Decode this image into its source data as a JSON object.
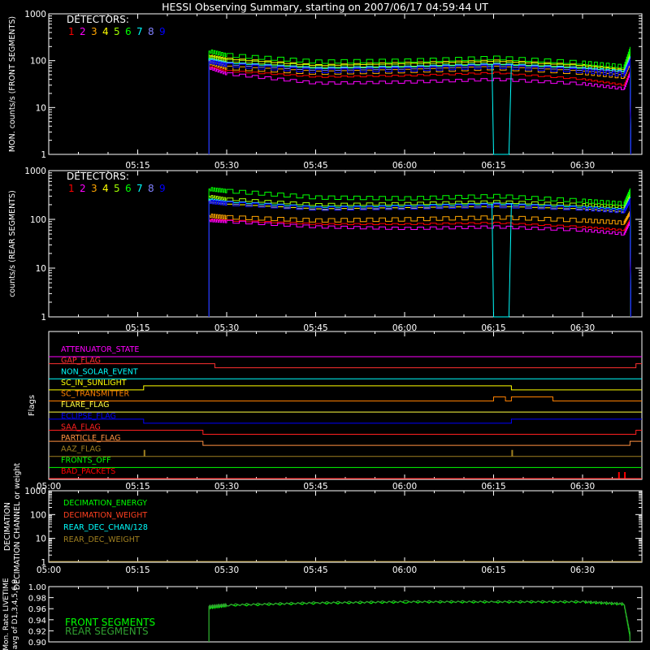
{
  "page_title": "HESSI Observing Summary, starting on 2007/06/17 04:59:44 UT",
  "time_axis": {
    "start": "05:00",
    "end": "06:40",
    "ticks": [
      "05:00",
      "05:15",
      "05:30",
      "05:45",
      "06:00",
      "06:15",
      "06:30"
    ],
    "panel_ticks": [
      "05:15",
      "05:30",
      "05:45",
      "06:00",
      "06:15",
      "06:30"
    ]
  },
  "detector_colors": [
    "#ff0000",
    "#ff00ff",
    "#ffa500",
    "#ffff00",
    "#a0ff00",
    "#00ff00",
    "#00ffff",
    "#8080ff",
    "#0000ff"
  ],
  "chart_data": [
    {
      "type": "line",
      "title": "HESSI Observing Summary, starting on 2007/06/17 04:59:44 UT",
      "ylabel": "MON. counts/s (FRONT SEGMENTS)",
      "yscale": "log",
      "ylim": [
        1,
        1000
      ],
      "ytick_labels": [
        "1",
        "10",
        "100",
        "1000"
      ],
      "legend_title": "DETECTORS:",
      "legend": [
        "1",
        "2",
        "3",
        "4",
        "5",
        "6",
        "7",
        "8",
        "9"
      ],
      "xticks": [
        "05:15",
        "05:30",
        "05:45",
        "06:00",
        "06:15",
        "06:30"
      ],
      "x": [
        "05:27",
        "05:30",
        "05:45",
        "06:00",
        "06:15",
        "06:30",
        "06:37",
        "06:38"
      ],
      "series": [
        {
          "name": "1",
          "color": "#ff0000",
          "values": [
            75,
            60,
            45,
            48,
            55,
            40,
            30,
            60
          ]
        },
        {
          "name": "2",
          "color": "#ff00ff",
          "values": [
            70,
            52,
            33,
            35,
            40,
            32,
            25,
            55
          ]
        },
        {
          "name": "3",
          "color": "#ffa500",
          "values": [
            90,
            70,
            55,
            60,
            70,
            55,
            45,
            90
          ]
        },
        {
          "name": "4",
          "color": "#ffff00",
          "values": [
            130,
            110,
            80,
            90,
            100,
            80,
            65,
            150
          ]
        },
        {
          "name": "5",
          "color": "#a0ff00",
          "values": [
            120,
            100,
            75,
            80,
            90,
            75,
            60,
            140
          ]
        },
        {
          "name": "6",
          "color": "#00ff00",
          "values": [
            160,
            130,
            95,
            100,
            115,
            90,
            75,
            180
          ]
        },
        {
          "name": "7",
          "color": "#00ffff",
          "values": [
            110,
            90,
            70,
            75,
            85,
            70,
            60,
            120
          ]
        },
        {
          "name": "8",
          "color": "#8080ff",
          "values": [
            100,
            85,
            65,
            70,
            80,
            65,
            55,
            110
          ]
        },
        {
          "name": "9",
          "color": "#0000ff",
          "values": [
            95,
            80,
            60,
            65,
            75,
            60,
            50,
            100
          ]
        }
      ]
    },
    {
      "type": "line",
      "ylabel": "counts/s (REAR SEGMENTS)",
      "yscale": "log",
      "ylim": [
        1,
        1000
      ],
      "ytick_labels": [
        "1",
        "10",
        "100",
        "1000"
      ],
      "legend_title": "DETECTORS:",
      "legend": [
        "1",
        "2",
        "3",
        "4",
        "5",
        "6",
        "7",
        "8",
        "9"
      ],
      "xticks": [
        "05:15",
        "05:30",
        "05:45",
        "06:00",
        "06:15",
        "06:30"
      ],
      "x": [
        "05:27",
        "05:30",
        "05:45",
        "06:00",
        "06:15",
        "06:30",
        "06:37",
        "06:38"
      ],
      "series": [
        {
          "name": "1",
          "color": "#ff0000",
          "values": [
            100,
            95,
            80,
            80,
            85,
            70,
            60,
            100
          ]
        },
        {
          "name": "2",
          "color": "#ff00ff",
          "values": [
            95,
            90,
            70,
            65,
            70,
            60,
            50,
            90
          ]
        },
        {
          "name": "3",
          "color": "#ffa500",
          "values": [
            120,
            110,
            95,
            100,
            110,
            95,
            85,
            140
          ]
        },
        {
          "name": "4",
          "color": "#ffff00",
          "values": [
            220,
            200,
            160,
            170,
            180,
            160,
            140,
            250
          ]
        },
        {
          "name": "5",
          "color": "#a0ff00",
          "values": [
            300,
            260,
            200,
            210,
            230,
            200,
            180,
            320
          ]
        },
        {
          "name": "6",
          "color": "#00ff00",
          "values": [
            420,
            380,
            280,
            270,
            300,
            240,
            210,
            400
          ]
        },
        {
          "name": "7",
          "color": "#00ffff",
          "values": [
            260,
            230,
            180,
            190,
            210,
            180,
            160,
            280
          ]
        },
        {
          "name": "8",
          "color": "#8080ff",
          "values": [
            240,
            220,
            170,
            180,
            200,
            170,
            150,
            260
          ]
        },
        {
          "name": "9",
          "color": "#0000ff",
          "values": [
            230,
            210,
            165,
            175,
            190,
            165,
            145,
            250
          ]
        }
      ]
    },
    {
      "type": "line",
      "ylabel": "Flags",
      "xticks": [
        "05:00",
        "05:15",
        "05:30",
        "05:45",
        "06:00",
        "06:15",
        "06:30"
      ],
      "series": [
        {
          "name": "ATTENUATOR_STATE",
          "color": "#ff00ff",
          "segments": [
            [
              "05:00",
              "06:40",
              0
            ]
          ]
        },
        {
          "name": "GAP_FLAG",
          "color": "#ff3030",
          "segments": [
            [
              "05:00",
              "05:28",
              1
            ],
            [
              "05:28",
              "06:39",
              0
            ],
            [
              "06:39",
              "06:40",
              1
            ]
          ]
        },
        {
          "name": "NON_SOLAR_EVENT",
          "color": "#00ffff",
          "segments": [
            [
              "05:00",
              "06:40",
              0
            ]
          ]
        },
        {
          "name": "SC_IN_SUNLIGHT",
          "color": "#ffff00",
          "segments": [
            [
              "05:00",
              "05:16",
              0
            ],
            [
              "05:16",
              "06:18",
              1
            ],
            [
              "06:18",
              "06:40",
              0
            ]
          ]
        },
        {
          "name": "SC_TRANSMITTER",
          "color": "#ff8000",
          "segments": [
            [
              "05:00",
              "06:15",
              0
            ],
            [
              "06:15",
              "06:17",
              1
            ],
            [
              "06:17",
              "06:18",
              0
            ],
            [
              "06:18",
              "06:25",
              1
            ],
            [
              "06:25",
              "06:40",
              0
            ]
          ]
        },
        {
          "name": "FLARE_FLAG",
          "color": "#ffff40",
          "segments": [
            [
              "05:00",
              "06:40",
              0
            ]
          ]
        },
        {
          "name": "ECLIPSE_FLAG",
          "color": "#0000ff",
          "segments": [
            [
              "05:00",
              "05:16",
              1
            ],
            [
              "05:16",
              "06:18",
              0
            ],
            [
              "06:18",
              "06:40",
              1
            ]
          ]
        },
        {
          "name": "SAA_FLAG",
          "color": "#ff2020",
          "segments": [
            [
              "05:00",
              "05:26",
              1
            ],
            [
              "05:26",
              "06:39",
              0
            ],
            [
              "06:39",
              "06:40",
              1
            ]
          ]
        },
        {
          "name": "PARTICLE_FLAG",
          "color": "#ff9040",
          "segments": [
            [
              "05:00",
              "05:26",
              1
            ],
            [
              "05:26",
              "06:38",
              0
            ],
            [
              "06:38",
              "06:40",
              1
            ]
          ]
        },
        {
          "name": "AAZ_FLAG",
          "color": "#a08020",
          "segments": [
            [
              "05:00",
              "06:40",
              0
            ]
          ],
          "spikes": [
            "05:16",
            "06:18"
          ]
        },
        {
          "name": "FRONTS_OFF",
          "color": "#00ff00",
          "segments": [
            [
              "05:00",
              "06:40",
              0
            ]
          ]
        },
        {
          "name": "BAD_PACKETS",
          "color": "#ff0000",
          "segments": [
            [
              "05:00",
              "06:40",
              0
            ]
          ],
          "spikes": [
            "06:36",
            "06:37"
          ]
        }
      ]
    },
    {
      "type": "line",
      "ylabel": "DECIMATION CHANNEL or weight",
      "yscale": "log",
      "ylim": [
        1,
        1000
      ],
      "ytick_labels": [
        "1",
        "10",
        "100",
        "1000"
      ],
      "xticks": [
        "05:00",
        "05:15",
        "05:30",
        "05:45",
        "06:00",
        "06:15",
        "06:30"
      ],
      "legend": [
        "DECIMATION_ENERGY",
        "DECIMATION_WEIGHT",
        "REAR_DEC_CHAN/128",
        "REAR_DEC_WEIGHT"
      ],
      "series": [
        {
          "name": "DECIMATION_ENERGY",
          "color": "#00ff00",
          "values": [
            1,
            1
          ]
        },
        {
          "name": "DECIMATION_WEIGHT",
          "color": "#ff4020",
          "values": [
            1,
            1
          ]
        },
        {
          "name": "REAR_DEC_CHAN/128",
          "color": "#00ffff",
          "values": [
            1,
            1
          ]
        },
        {
          "name": "REAR_DEC_WEIGHT",
          "color": "#a08020",
          "values": [
            1,
            1
          ]
        }
      ]
    },
    {
      "type": "line",
      "ylabel": "Mon. Rate LIVETIME avg of D1,3,4,5,6,9",
      "ylim": [
        0.9,
        1.0
      ],
      "ytick_labels": [
        "0.90",
        "0.92",
        "0.94",
        "0.96",
        "0.98",
        "1.00"
      ],
      "legend": [
        "FRONT SEGMENTS",
        "REAR SEGMENTS"
      ],
      "x": [
        "05:27",
        "05:30",
        "05:45",
        "06:00",
        "06:15",
        "06:30",
        "06:37",
        "06:38"
      ],
      "series": [
        {
          "name": "FRONT SEGMENTS",
          "color": "#00ff00",
          "values": [
            0.962,
            0.966,
            0.97,
            0.972,
            0.972,
            0.972,
            0.968,
            0.91
          ]
        },
        {
          "name": "REAR SEGMENTS",
          "color": "#30a030",
          "values": [
            0.964,
            0.967,
            0.971,
            0.973,
            0.973,
            0.973,
            0.969,
            0.915
          ]
        }
      ]
    }
  ]
}
